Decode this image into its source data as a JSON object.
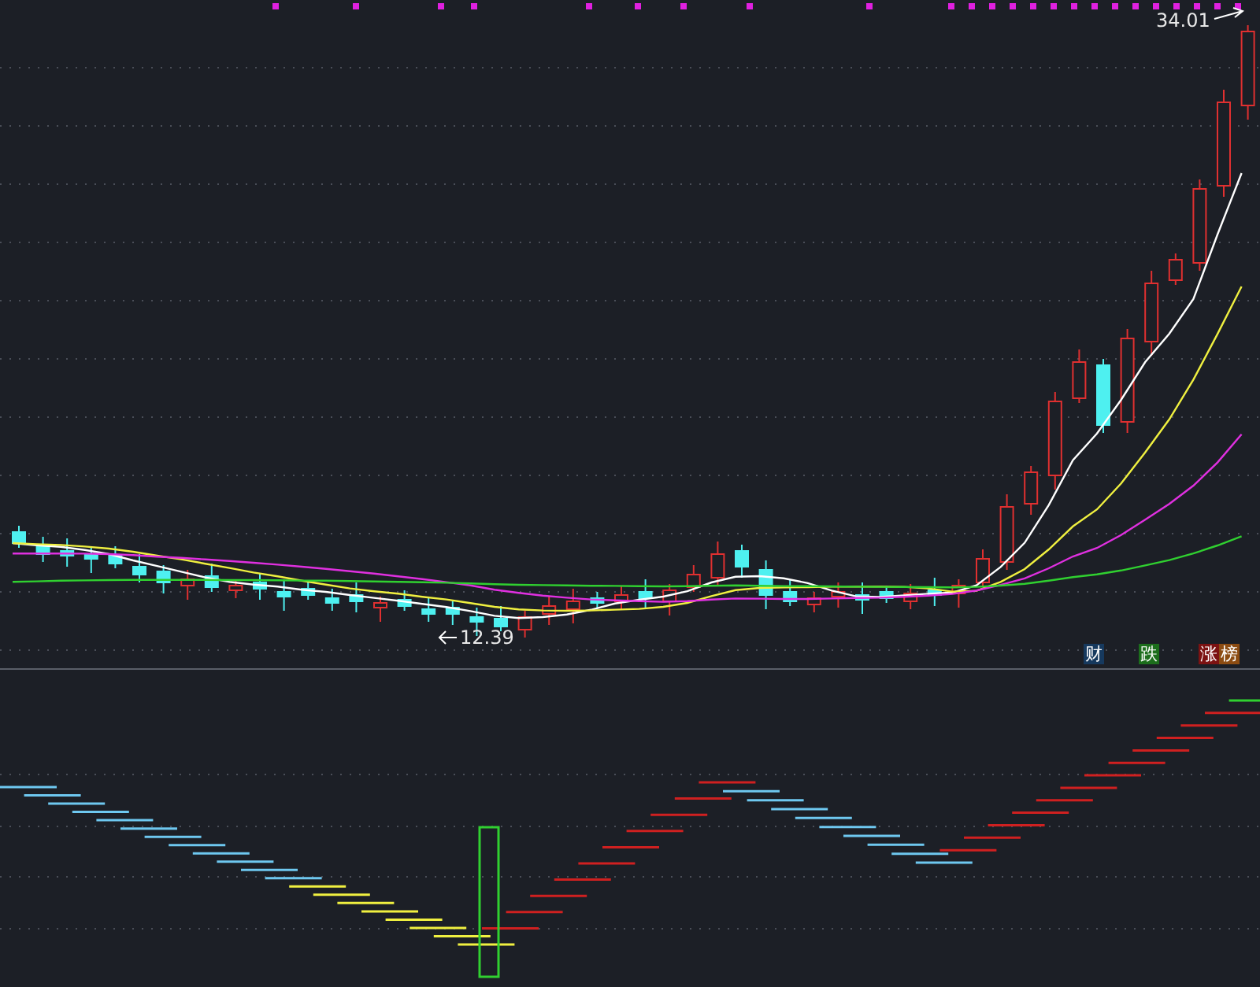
{
  "price_labels": [
    {
      "kind": "high",
      "text": "34.01"
    },
    {
      "kind": "low",
      "text": "12.39"
    }
  ],
  "badges": [
    {
      "text": "财",
      "color": "#16395e"
    },
    {
      "text": "跌",
      "color": "#1c6e1c"
    },
    {
      "text": "涨",
      "color": "#7c1212"
    },
    {
      "text": "榜",
      "color": "#8c4c12"
    }
  ]
}
